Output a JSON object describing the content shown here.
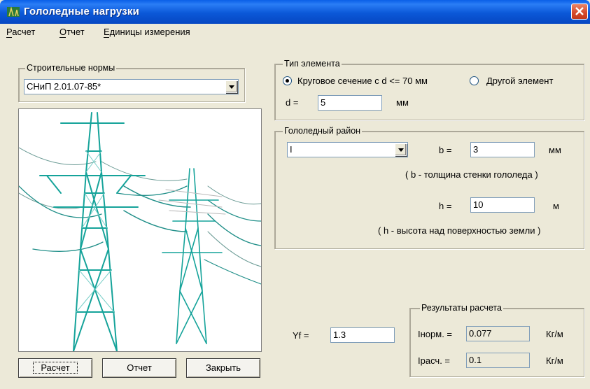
{
  "window": {
    "title": "Гололедные нагрузки"
  },
  "menu": [
    {
      "label": "Расчет",
      "accel": "Р"
    },
    {
      "label": "Отчет",
      "accel": "О"
    },
    {
      "label": "Единицы измерения",
      "accel": "Е"
    }
  ],
  "norms": {
    "legend": "Строительные нормы",
    "selected": "СНиП 2.01.07-85*"
  },
  "element_type": {
    "legend": "Тип элемента",
    "option_circular": "Круговое сечение с d <= 70 мм",
    "option_other": "Другой элемент",
    "selected": "circular",
    "d_label": "d =",
    "d_value": "5",
    "d_unit": "мм"
  },
  "ice_region": {
    "legend": "Гололедный район",
    "selected": "I",
    "b_label": "b =",
    "b_value": "3",
    "b_unit": "мм",
    "b_note": "( b - толщина стенки гололеда )",
    "h_label": "h =",
    "h_value": "10",
    "h_unit": "м",
    "h_note": "( h - высота над поверхностью земли )"
  },
  "gamma": {
    "label": "Yf =",
    "value": "1.3"
  },
  "results": {
    "legend": "Результаты расчета",
    "norm_label": "Iнорм. =",
    "norm_value": "0.077",
    "norm_unit": "Кг/м",
    "calc_label": "Iрасч. =",
    "calc_value": "0.1",
    "calc_unit": "Кг/м"
  },
  "buttons": {
    "calc": "Расчет",
    "report": "Отчет",
    "close": "Закрыть"
  },
  "colors": {
    "tower": "#15a39a",
    "titlebar": "#0b58d8"
  }
}
